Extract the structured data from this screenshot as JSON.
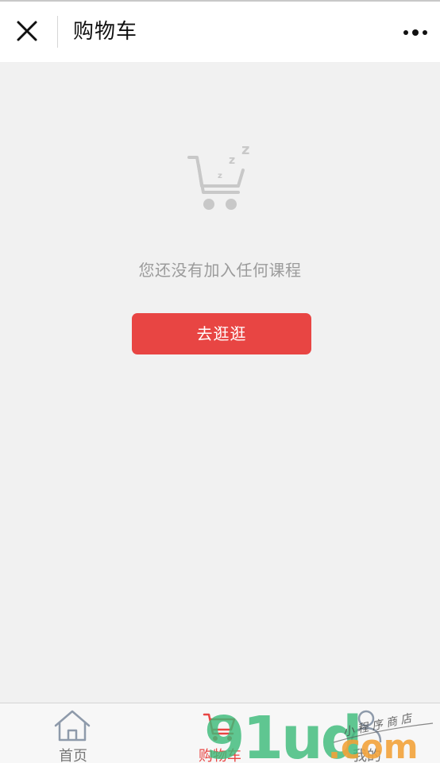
{
  "navbar": {
    "title": "购物车",
    "close_icon": "close-icon",
    "more_icon": "more-dots-icon"
  },
  "empty_state": {
    "icon": "sleeping-cart-icon",
    "message": "您还没有加入任何课程",
    "button_label": "去逛逛"
  },
  "tabbar": {
    "tabs": [
      {
        "label": "首页",
        "icon": "home-icon",
        "active": false
      },
      {
        "label": "购物车",
        "icon": "cart-icon",
        "active": true
      },
      {
        "label": "我的",
        "icon": "user-icon",
        "active": false
      }
    ]
  },
  "watermark": {
    "text": "91ud.com",
    "script_text": "小程序商店"
  },
  "colors": {
    "accent": "#e84543",
    "page_bg": "#f1f1f1",
    "muted_text": "#9b9b9b"
  }
}
